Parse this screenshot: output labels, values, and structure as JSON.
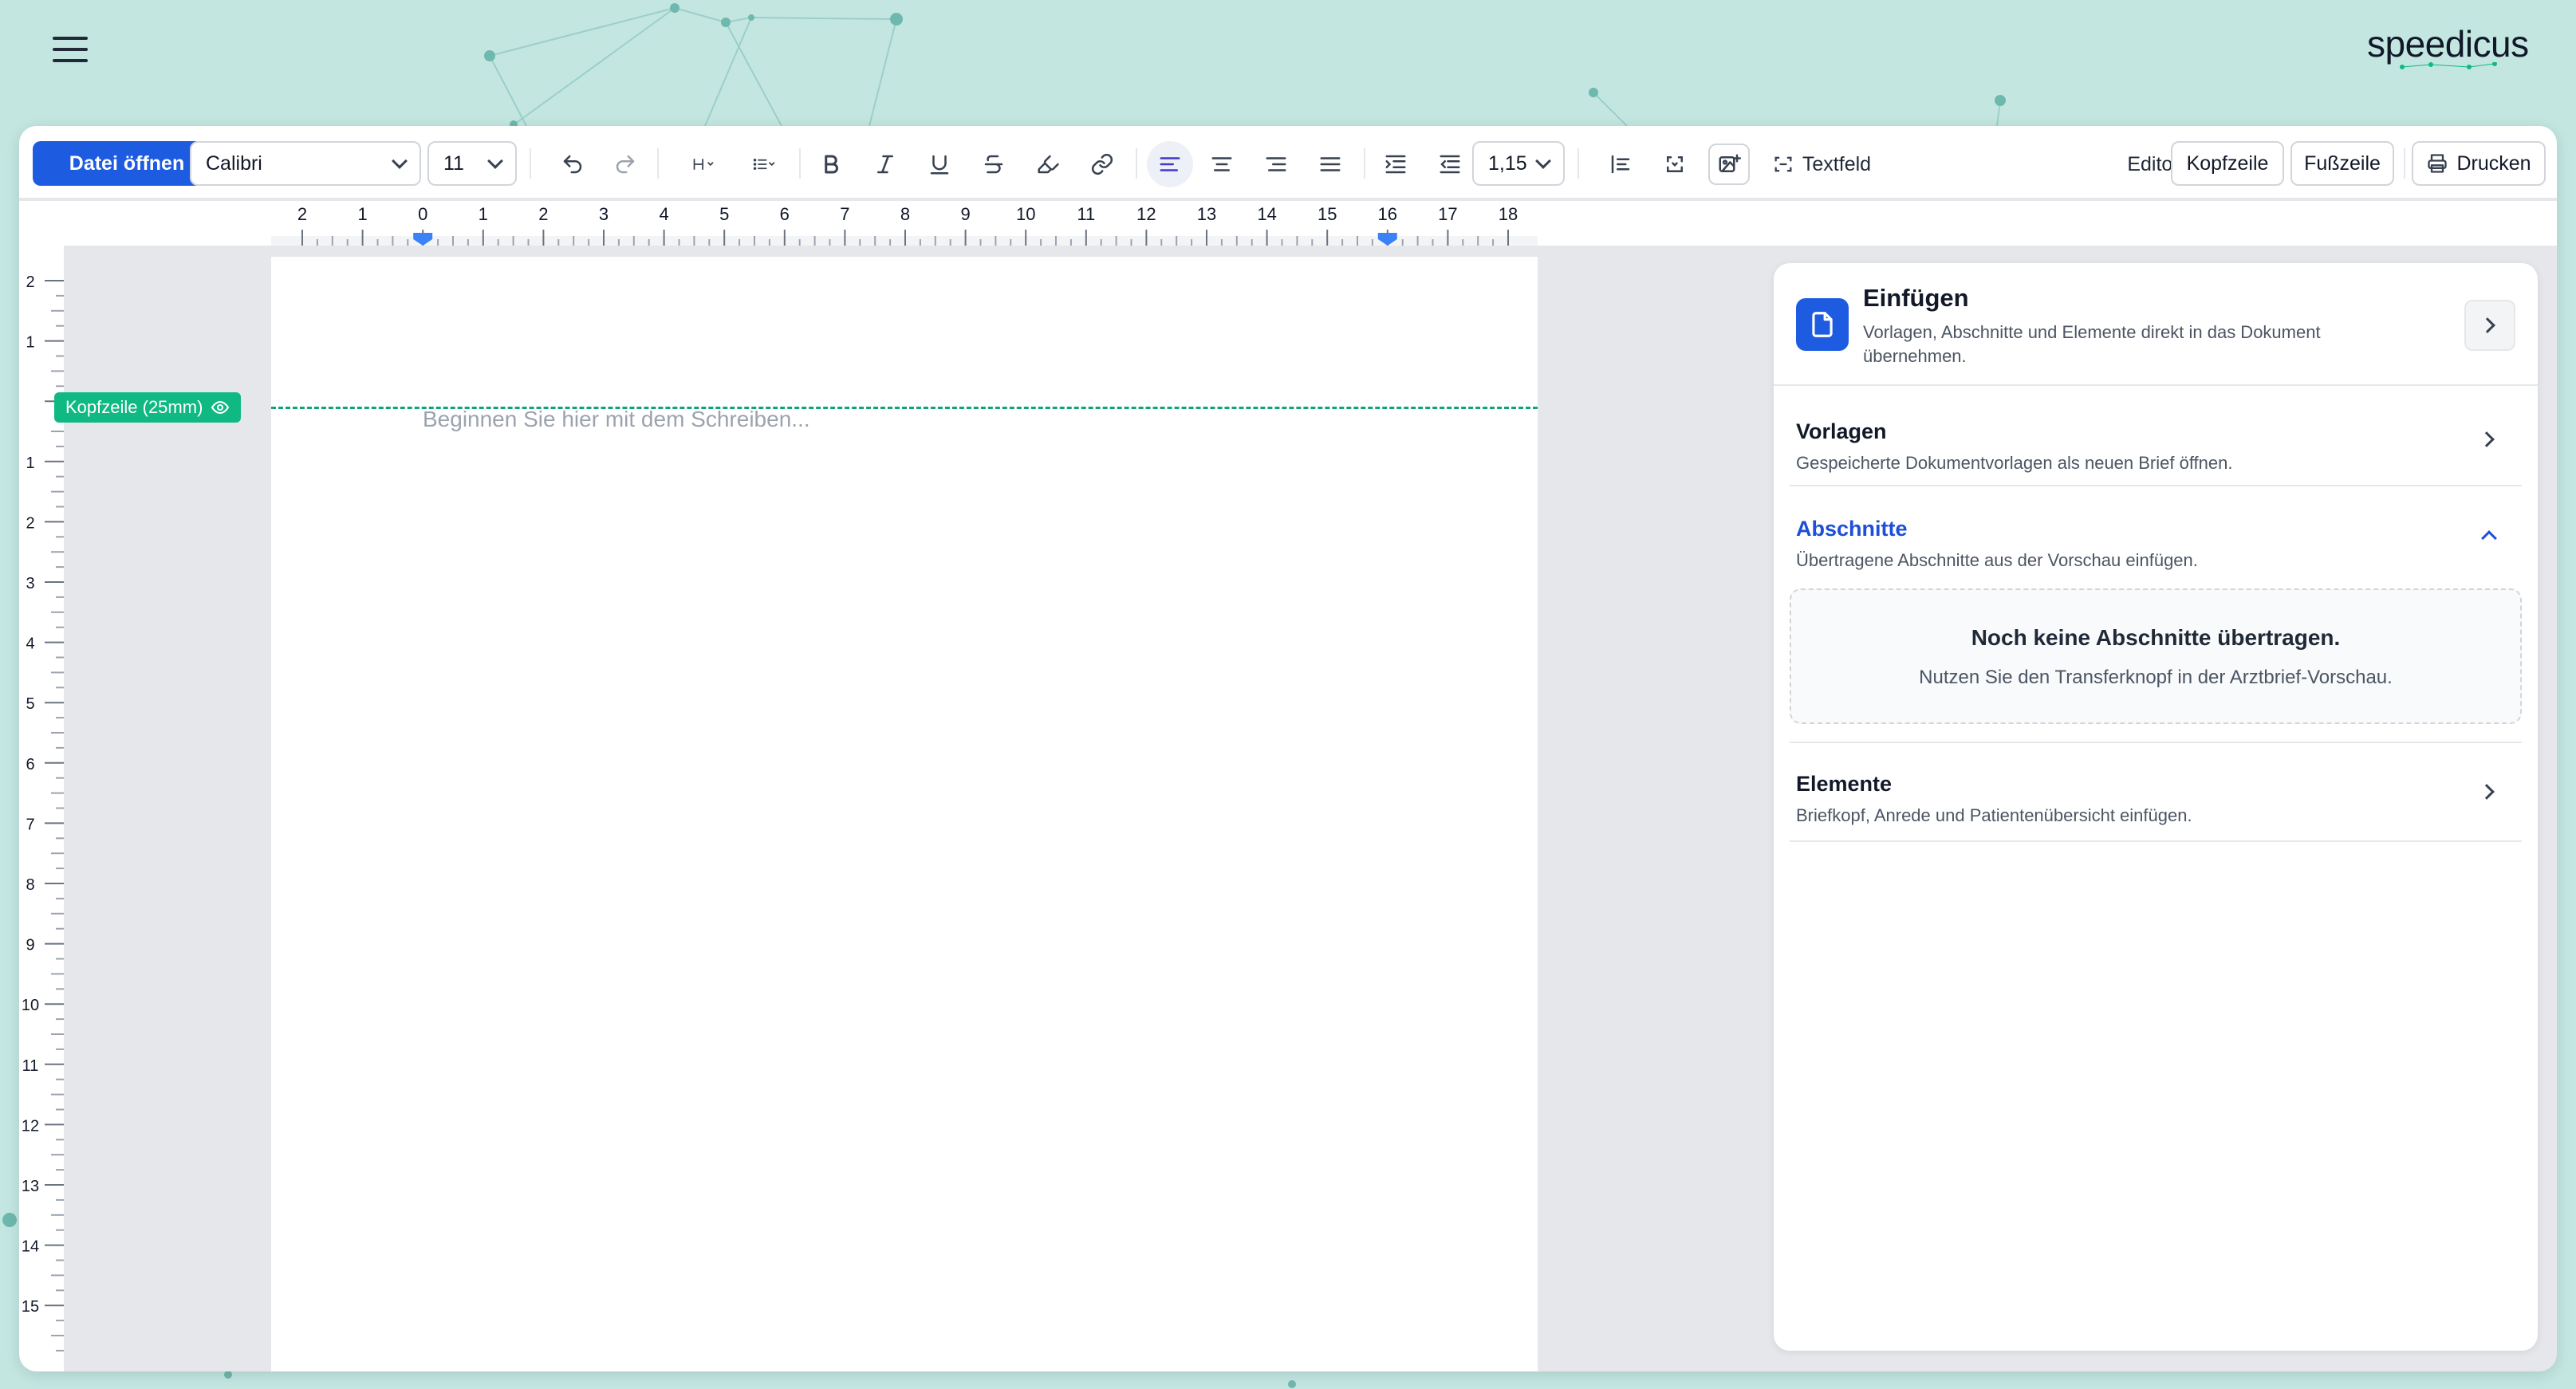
{
  "brand": {
    "logo": "speedicus"
  },
  "toolbar": {
    "open_file_label": "Datei öffnen",
    "font_family": "Calibri",
    "font_size": "11",
    "line_height": "1,15",
    "textfield_label": "Textfeld",
    "editor_label": "Editor",
    "header_label": "Kopfzeile",
    "footer_label": "Fußzeile",
    "print_label": "Drucken"
  },
  "ruler": {
    "horizontal_labels": [
      "2",
      "1",
      "0",
      "1",
      "2",
      "3",
      "4",
      "5",
      "6",
      "7",
      "8",
      "9",
      "10",
      "11",
      "12",
      "13",
      "14",
      "15",
      "16",
      "17",
      "18"
    ],
    "vertical_labels": [
      "2",
      "1",
      "",
      "1",
      "2",
      "3",
      "4",
      "5",
      "6",
      "7",
      "8",
      "9",
      "10",
      "11",
      "12",
      "13",
      "14",
      "15"
    ]
  },
  "document": {
    "header_badge": "Kopfzeile (25mm)",
    "placeholder": "Beginnen Sie hier mit dem Schreiben..."
  },
  "panel": {
    "title": "Einfügen",
    "subtitle": "Vorlagen, Abschnitte und Elemente direkt in das Dokument übernehmen.",
    "sections": {
      "templates": {
        "title": "Vorlagen",
        "subtitle": "Gespeicherte Dokumentvorlagen als neuen Brief öffnen."
      },
      "sections": {
        "title": "Abschnitte",
        "subtitle": "Übertragene Abschnitte aus der Vorschau einfügen."
      },
      "elements": {
        "title": "Elemente",
        "subtitle": "Briefkopf, Anrede und Patientenübersicht einfügen."
      }
    },
    "empty": {
      "title": "Noch keine Abschnitte übertragen.",
      "subtitle": "Nutzen Sie den Transferknopf in der Arztbrief-Vorschau."
    }
  },
  "colors": {
    "primary": "#1d5be0",
    "header_green": "#10b981",
    "background": "#c3e6e1",
    "active_section": "#1d4fd8"
  }
}
